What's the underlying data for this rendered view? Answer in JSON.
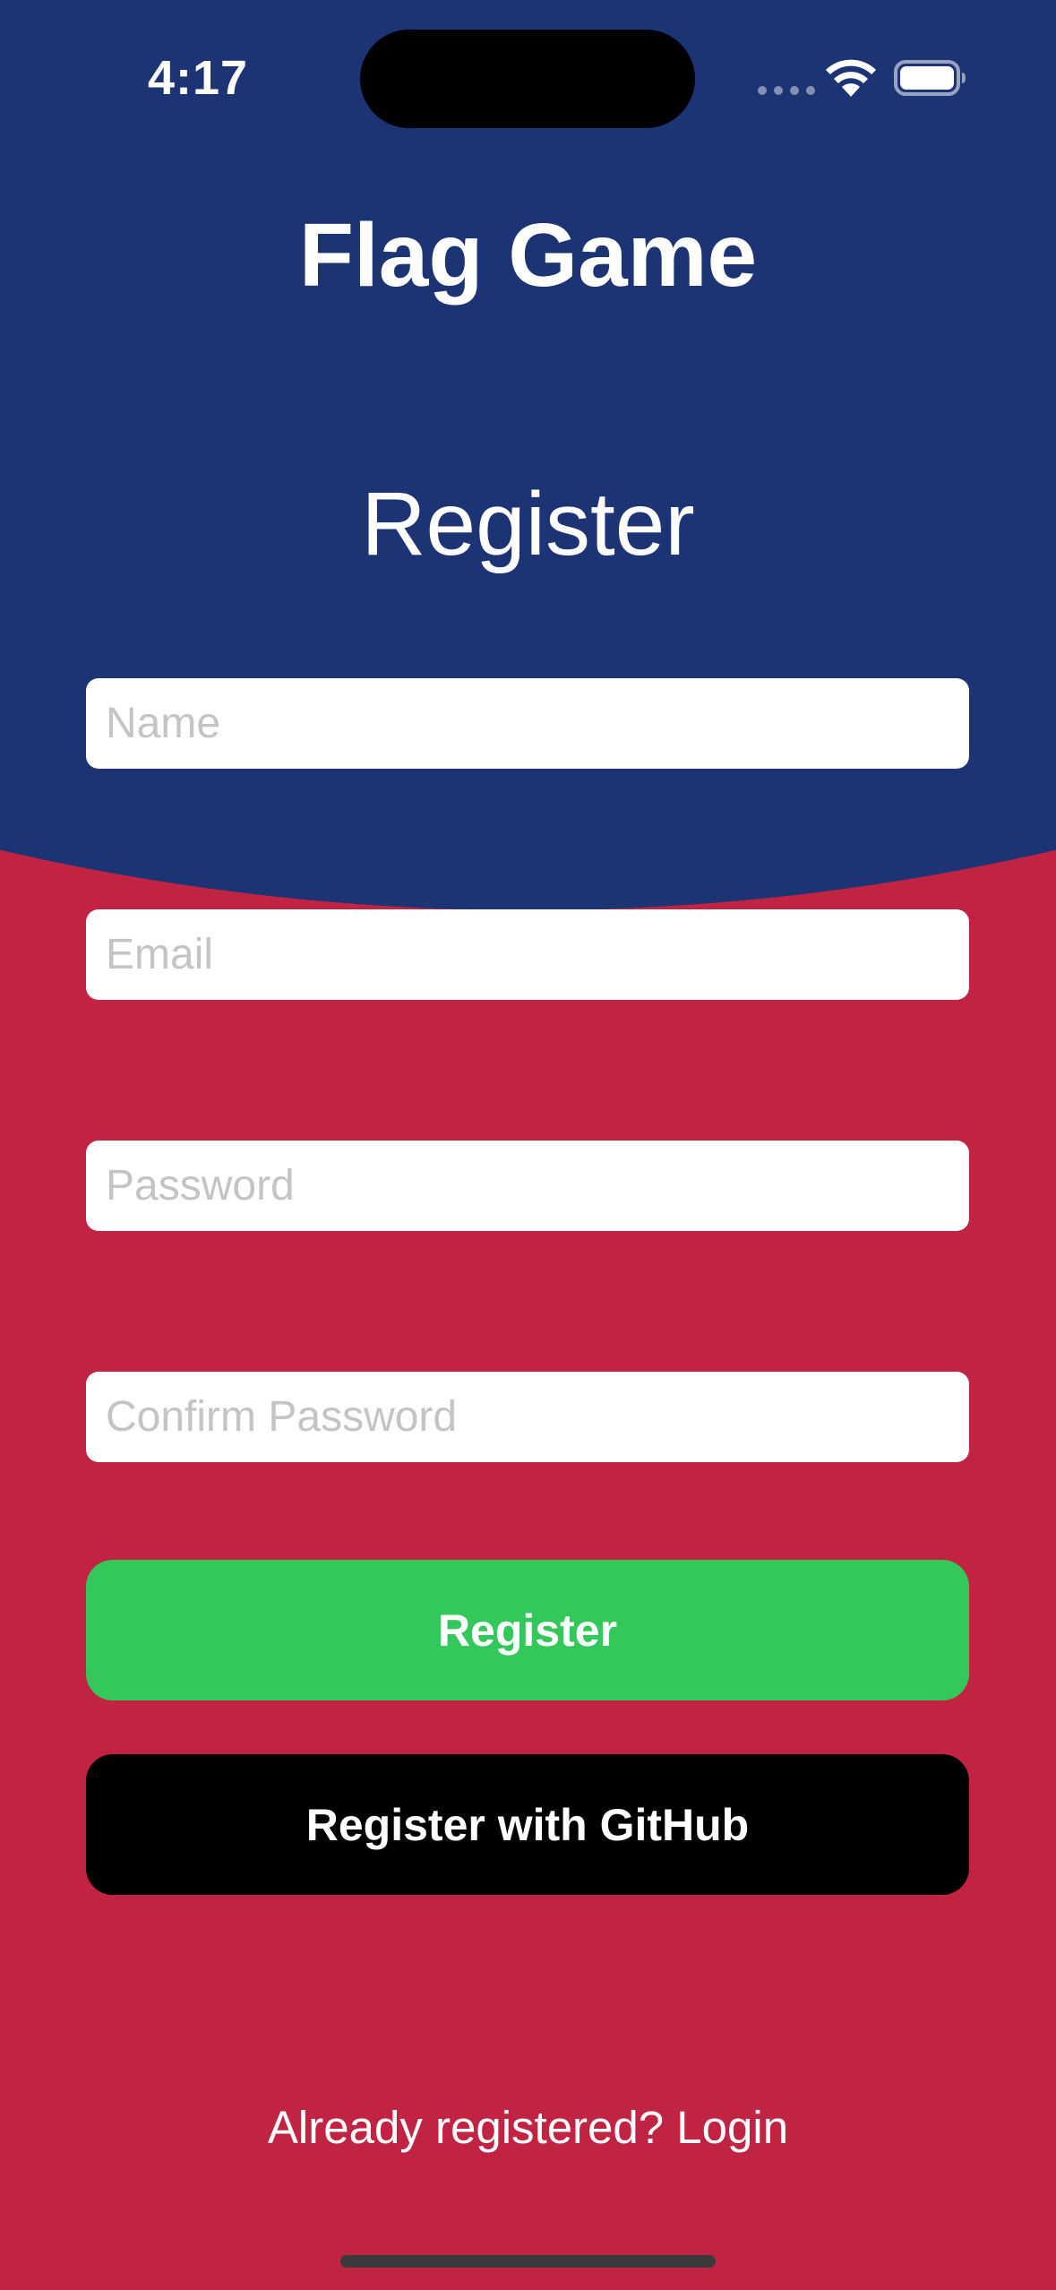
{
  "status_bar": {
    "time": "4:17",
    "icons": [
      "signal-dots-icon",
      "wifi-icon",
      "battery-icon"
    ]
  },
  "header": {
    "app_title": "Flag Game",
    "page_title": "Register"
  },
  "form": {
    "name_placeholder": "Name",
    "name_value": "",
    "email_placeholder": "Email",
    "email_value": "",
    "password_placeholder": "Password",
    "password_value": "",
    "confirm_placeholder": "Confirm Password",
    "confirm_value": ""
  },
  "buttons": {
    "register_label": "Register",
    "github_label": "Register with GitHub"
  },
  "footer": {
    "login_link": "Already registered? Login"
  },
  "colors": {
    "top_blue": "#1c3374",
    "background_red": "#c02442",
    "register_green": "#34c75a",
    "github_black": "#000000"
  }
}
